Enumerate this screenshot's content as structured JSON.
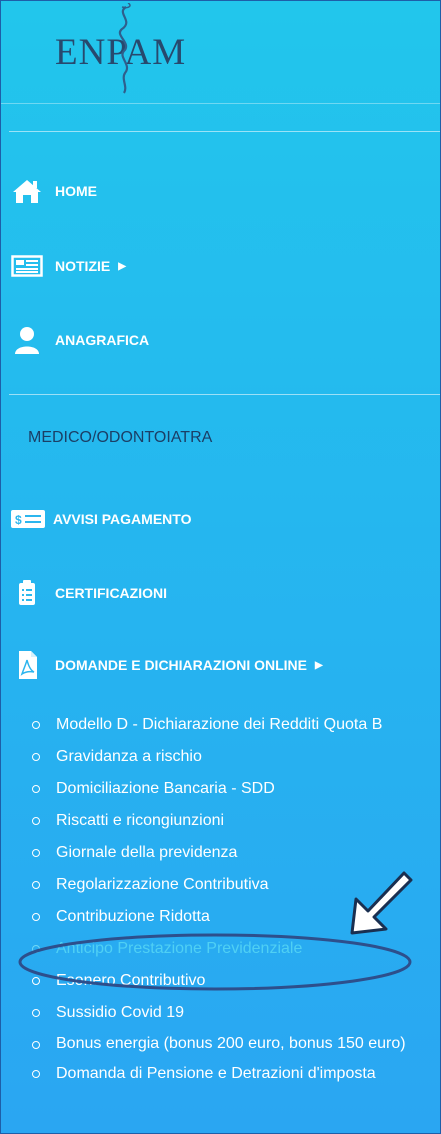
{
  "brand": {
    "logo_text": "ENPAM"
  },
  "menu": {
    "home": "HOME",
    "notizie": "NOTIZIE",
    "anagrafica": "ANAGRAFICA"
  },
  "section": {
    "title": "MEDICO/ODONTOIATRA"
  },
  "services": {
    "avvisi": "AVVISI PAGAMENTO",
    "avvisi_icon_text": "$",
    "certificazioni": "CERTIFICAZIONI",
    "domande": "DOMANDE E DICHIARAZIONI ONLINE"
  },
  "submenu": [
    "Modello D - Dichiarazione dei Redditi Quota B",
    "Gravidanza a rischio",
    "Domiciliazione Bancaria - SDD",
    "Riscatti e ricongiunzioni",
    "Giornale della previdenza",
    "Regolarizzazione Contributiva",
    "Contribuzione Ridotta",
    "Anticipo Prestazione Previdenziale",
    "Esonero Contributivo",
    "Sussidio Covid 19",
    "Bonus energia (bonus 200 euro, bonus 150 euro)",
    "Domanda di Pensione e Detrazioni d'imposta"
  ],
  "icons": {
    "home": "home-icon",
    "notizie": "newspaper-icon",
    "anagrafica": "user-icon",
    "avvisi": "payment-slip-icon",
    "certificazioni": "clipboard-icon",
    "domande": "pdf-document-icon"
  },
  "colors": {
    "background_top": "#22c6ec",
    "background_bottom": "#2aa6f2",
    "logo": "#27496e",
    "section_title": "#1b3f66",
    "highlight_ellipse": "#2d4f8c",
    "faded_item": "#4fd0f4"
  }
}
